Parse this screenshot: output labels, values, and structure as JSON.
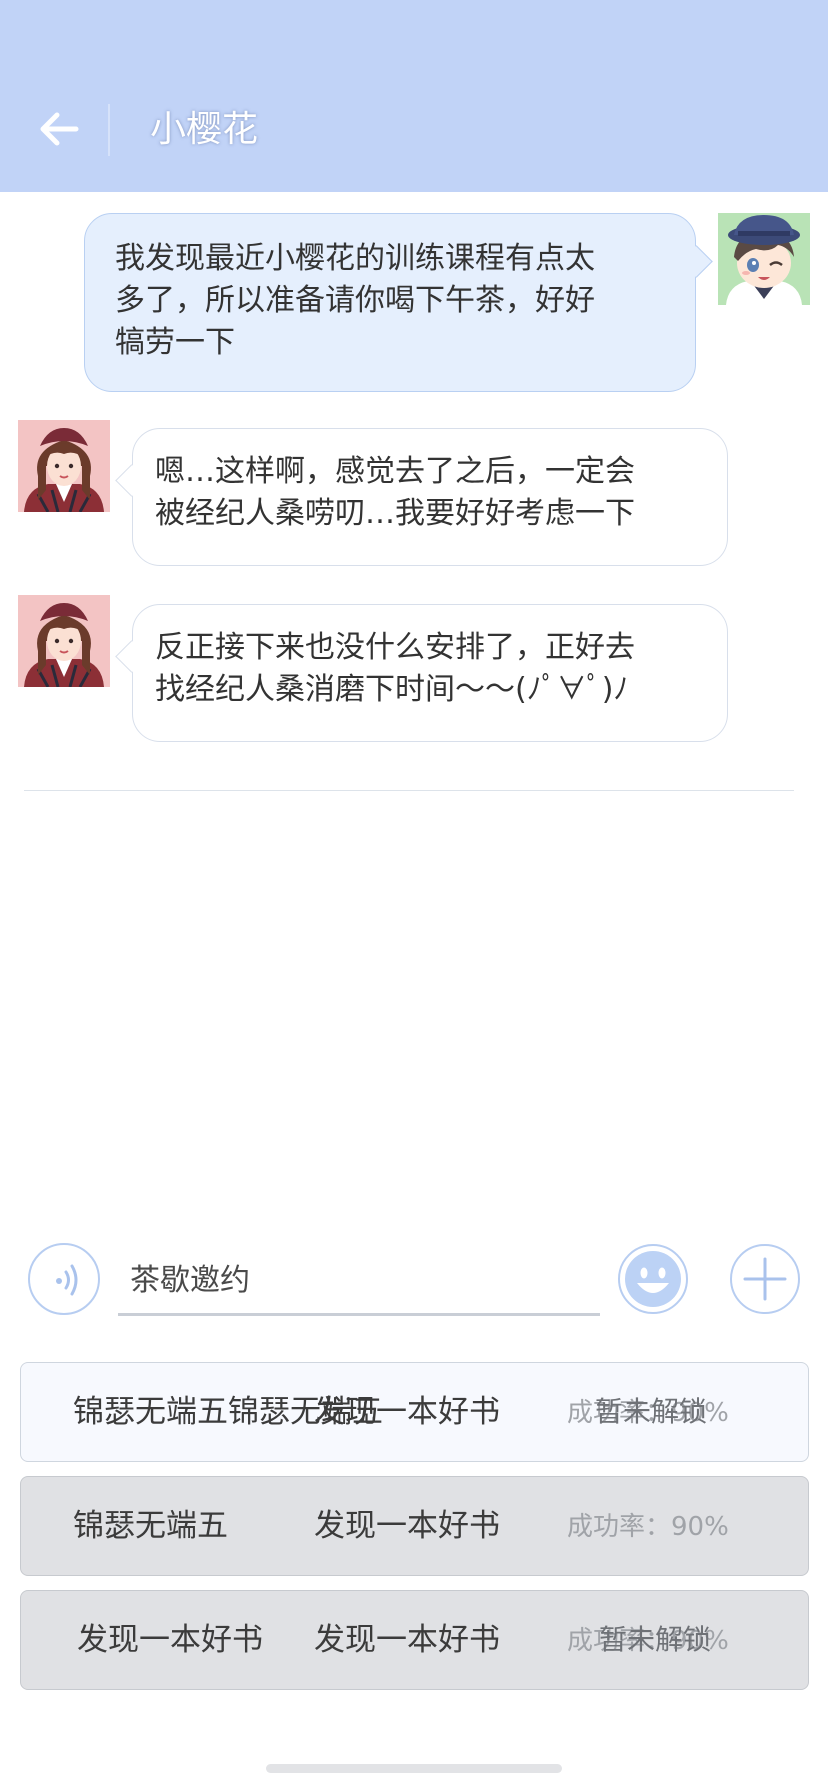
{
  "header": {
    "title": "小樱花",
    "back_icon": "arrow-left-icon",
    "background_color": "#c1d3f7"
  },
  "messages": [
    {
      "sender": "self",
      "text": "我发现最近小樱花的训练课程有点太\n多了，所以准备请你喝下午茶，好好\n犒劳一下"
    },
    {
      "sender": "contact",
      "text": "嗯…这样啊，感觉去了之后，一定会\n被经纪人桑唠叨…我要好好考虑一下"
    },
    {
      "sender": "contact",
      "text": "反正接下来也没什么安排了，正好去\n找经纪人桑消磨下时间～～(ﾉﾟ∀ﾟ)ﾉ"
    }
  ],
  "input": {
    "value": "茶歇邀约",
    "voice_icon": "voice-icon",
    "emoji_icon": "smiley-icon",
    "plus_icon": "plus-icon"
  },
  "options": [
    {
      "text_a": "锦瑟无端五锦瑟无端五",
      "text_b": "发现一本好书",
      "rate": "成功率：90%",
      "status": "暂未解锁",
      "state": "highlighted"
    },
    {
      "text_a": "锦瑟无端五",
      "text_b": "发现一本好书",
      "rate": "成功率：90%",
      "state": "disabled"
    },
    {
      "text_a": "发现一本好书",
      "text_b": "发现一本好书",
      "rate": "成功率：90%",
      "status": "暂未解锁",
      "state": "disabled"
    }
  ],
  "colors": {
    "accent": "#b7cdf1",
    "self_bubble": "#e5effd",
    "option_disabled": "#e0e1e4"
  }
}
